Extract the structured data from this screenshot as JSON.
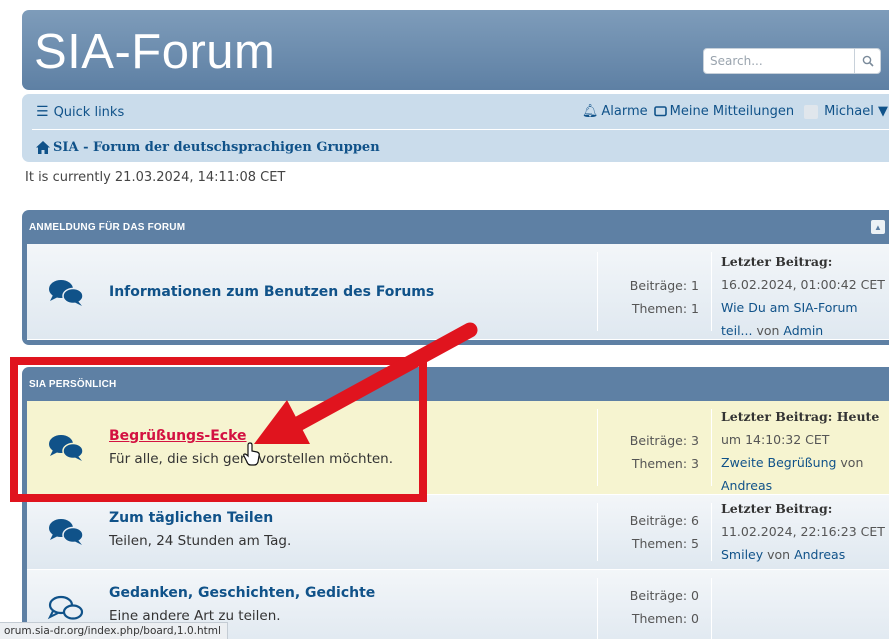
{
  "header": {
    "site_title": "SIA-Forum",
    "search_placeholder": "Search...",
    "search_icon": "magnifier-icon"
  },
  "navbar": {
    "quick_links": "Quick links",
    "alarms": "Alarme",
    "messages": "Meine Mitteilungen",
    "user": "Michael ▼",
    "breadcrumb": "SIA - Forum der deutschsprachigen Gruppen"
  },
  "current_time": "It is currently  21.03.2024, 14:11:08 CET",
  "categories": [
    {
      "header": "ANMELDUNG FÜR DAS FORUM",
      "forums": [
        {
          "title": "Informationen zum Benutzen des Forums",
          "description": "",
          "posts": "Beiträge: 1",
          "topics": "Themen: 1",
          "lastpost_label": "Letzter Beitrag:",
          "lastpost_line2": "16.02.2024, 01:00:42 CET",
          "lastpost_line3": "Wie Du am SIA-Forum",
          "lastpost_line4_link": "teil...",
          "lastpost_line4_by": " von ",
          "lastpost_line4_author": "Admin"
        }
      ]
    },
    {
      "header": "SIA PERSÖNLICH",
      "forums": [
        {
          "title": "Begrüßungs-Ecke",
          "description": "Für alle, die sich gern vorstellen möchten.",
          "posts": "Beiträge: 3",
          "topics": "Themen: 3",
          "lastpost_label": "Letzter Beitrag: Heute",
          "lastpost_line2": "um 14:10:32 CET",
          "lastpost_line3_link": "Zweite Begrüßung",
          "lastpost_line3_by": " von",
          "lastpost_line4_author": "Andreas"
        },
        {
          "title": "Zum täglichen Teilen",
          "description": "Teilen, 24 Stunden am Tag.",
          "posts": "Beiträge: 6",
          "topics": "Themen: 5",
          "lastpost_label": "Letzter Beitrag:",
          "lastpost_line2": "11.02.2024, 22:16:23 CET",
          "lastpost_line3_link": "Smiley",
          "lastpost_line3_by": " von ",
          "lastpost_line3_author": "Andreas"
        },
        {
          "title": "Gedanken, Geschichten, Gedichte",
          "description": "Eine andere Art zu teilen.",
          "posts": "Beiträge: 0",
          "topics": "Themen: 0"
        }
      ]
    }
  ],
  "status_bar_url": "orum.sia-dr.org/index.php/board,1.0.html",
  "colors": {
    "header_bg": "#5e80a4",
    "nav_bg": "#cadceb",
    "link": "#105289",
    "hover_link": "#d31141",
    "annotation_red": "#e0141e",
    "highlight_row": "#f6f4d0"
  }
}
